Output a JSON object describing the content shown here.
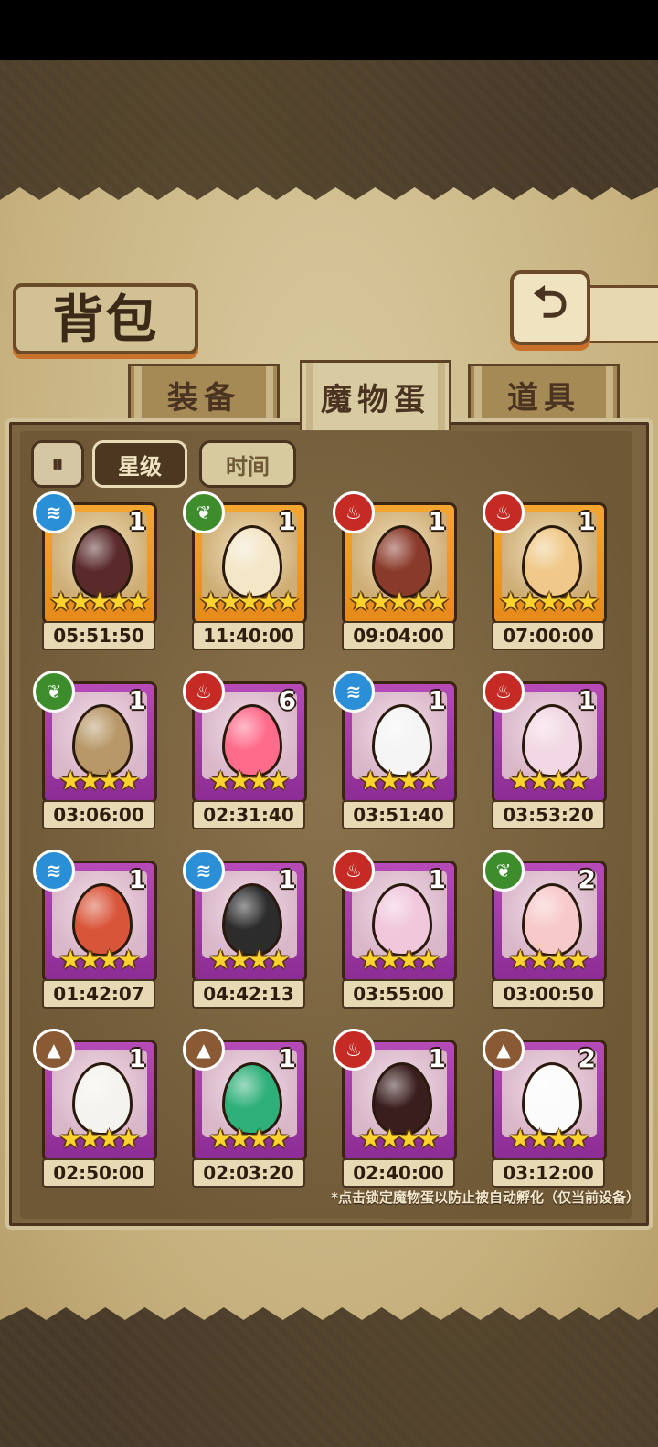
{
  "title": "背包",
  "back_icon": "back-arrow-icon",
  "tabs": [
    {
      "label": "装备",
      "active": false
    },
    {
      "label": "魔物蛋",
      "active": true
    },
    {
      "label": "道具",
      "active": false
    }
  ],
  "filters": {
    "pause_icon": "pause-icon",
    "star_label": "星级",
    "time_label": "时间",
    "selected": "星级"
  },
  "colors": {
    "legend_frame": "#f4a630",
    "epic_frame": "#b64bb8",
    "water": "#2a8fd6",
    "leaf": "#3d8d2c",
    "fire": "#c52a24",
    "earth": "#8a5a34"
  },
  "eggs": [
    {
      "element": "water",
      "rarity": "legend",
      "count": "1",
      "stars": "★★★★★",
      "time": "05:51:50",
      "egg_color": "#5a2a2a"
    },
    {
      "element": "leaf",
      "rarity": "legend",
      "count": "1",
      "stars": "★★★★★",
      "time": "11:40:00",
      "egg_color": "#f3e7c8"
    },
    {
      "element": "fire",
      "rarity": "legend",
      "count": "1",
      "stars": "★★★★★",
      "time": "09:04:00",
      "egg_color": "#8a3a2a"
    },
    {
      "element": "fire",
      "rarity": "legend",
      "count": "1",
      "stars": "★★★★★",
      "time": "07:00:00",
      "egg_color": "#f0c98a"
    },
    {
      "element": "leaf",
      "rarity": "epic",
      "count": "1",
      "stars": "★★★★",
      "time": "03:06:00",
      "egg_color": "#b89868"
    },
    {
      "element": "fire",
      "rarity": "epic",
      "count": "6",
      "stars": "★★★★",
      "time": "02:31:40",
      "egg_color": "#ff6b8a"
    },
    {
      "element": "water",
      "rarity": "epic",
      "count": "1",
      "stars": "★★★★",
      "time": "03:51:40",
      "egg_color": "#f5f5f5"
    },
    {
      "element": "fire",
      "rarity": "epic",
      "count": "1",
      "stars": "★★★★",
      "time": "03:53:20",
      "egg_color": "#f2d8e4"
    },
    {
      "element": "water",
      "rarity": "epic",
      "count": "1",
      "stars": "★★★★",
      "time": "01:42:07",
      "egg_color": "#d9553a"
    },
    {
      "element": "water",
      "rarity": "epic",
      "count": "1",
      "stars": "★★★★",
      "time": "04:42:13",
      "egg_color": "#2c2c2c"
    },
    {
      "element": "fire",
      "rarity": "epic",
      "count": "1",
      "stars": "★★★★",
      "time": "03:55:00",
      "egg_color": "#f1c7dc"
    },
    {
      "element": "leaf",
      "rarity": "epic",
      "count": "2",
      "stars": "★★★★",
      "time": "03:00:50",
      "egg_color": "#f7c9c8"
    },
    {
      "element": "earth",
      "rarity": "epic",
      "count": "1",
      "stars": "★★★★",
      "time": "02:50:00",
      "egg_color": "#f5f3ee"
    },
    {
      "element": "earth",
      "rarity": "epic",
      "count": "1",
      "stars": "★★★★",
      "time": "02:03:20",
      "egg_color": "#2fb07a"
    },
    {
      "element": "fire",
      "rarity": "epic",
      "count": "1",
      "stars": "★★★★",
      "time": "02:40:00",
      "egg_color": "#3a1e1e"
    },
    {
      "element": "earth",
      "rarity": "epic",
      "count": "2",
      "stars": "★★★★",
      "time": "03:12:00",
      "egg_color": "#fbfbfb"
    }
  ],
  "hint": "*点击锁定魔物蛋以防止被自动孵化（仅当前设备）"
}
